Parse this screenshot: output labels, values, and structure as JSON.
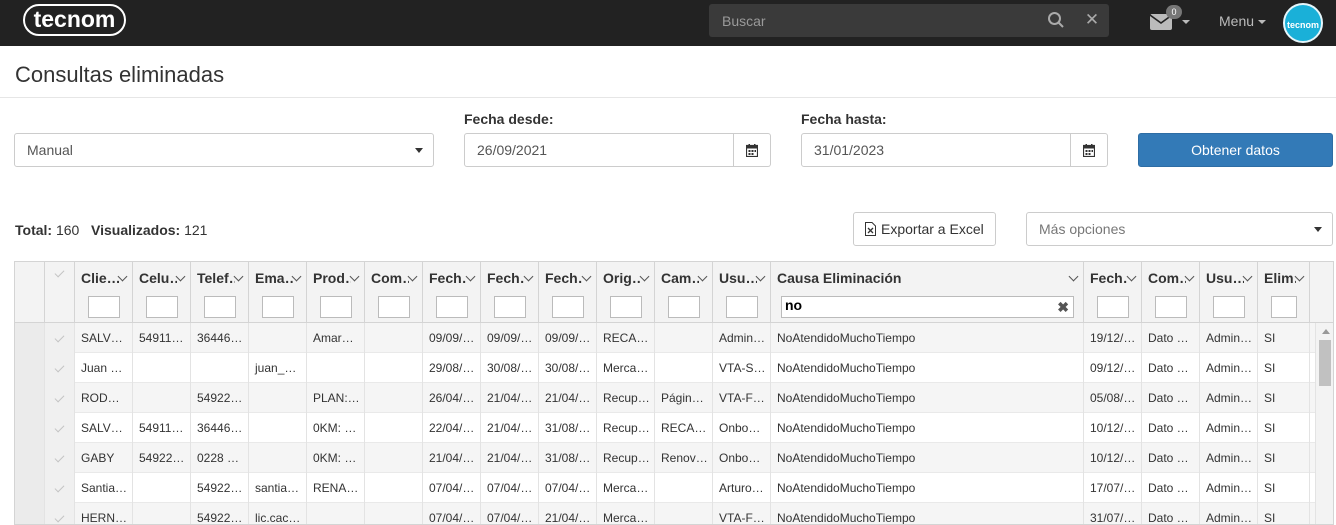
{
  "app": {
    "logo_text": "tecnom",
    "avatar_text": "tecnom",
    "accent": "#337ab7"
  },
  "topbar": {
    "search_placeholder": "Buscar",
    "mail_count": "0",
    "menu_label": "Menu"
  },
  "page": {
    "title": "Consultas eliminadas"
  },
  "filters": {
    "type_value": "Manual",
    "date_from_label": "Fecha desde:",
    "date_from_value": "26/09/2021",
    "date_to_label": "Fecha hasta:",
    "date_to_value": "31/01/2023",
    "submit_label": "Obtener datos"
  },
  "summary": {
    "total_label": "Total:",
    "total_value": "160",
    "visible_label": "Visualizados:",
    "visible_value": "121",
    "export_label": "Exportar a Excel",
    "more_options_value": "Más opciones"
  },
  "grid": {
    "columns": [
      "Clie…",
      "Celu…",
      "Telef…",
      "Ema…",
      "Prod…",
      "Com…",
      "Fech…",
      "Fech…",
      "Fech…",
      "Orig…",
      "Cam…",
      "Usu…",
      "Causa Eliminación",
      "Fech…",
      "Com…",
      "Usu…",
      "Elim…"
    ],
    "filter_values": [
      "",
      "",
      "",
      "",
      "",
      "",
      "",
      "",
      "",
      "",
      "",
      "",
      "no",
      "",
      "",
      "",
      ""
    ],
    "rows": [
      [
        "SALV…",
        "54911…",
        "36446…",
        "",
        "Amar…",
        "",
        "09/09/…",
        "09/09/…",
        "09/09/…",
        "RECA…",
        "",
        "Admin…",
        "NoAtendidoMuchoTiempo",
        "19/12/…",
        "Dato …",
        "Admin…",
        "SI"
      ],
      [
        "Juan …",
        "",
        "",
        "juan_…",
        "",
        "",
        "29/08/…",
        "30/08/…",
        "30/08/…",
        "Merca…",
        "",
        "VTA-S…",
        "NoAtendidoMuchoTiempo",
        "09/12/…",
        "Dato …",
        "Admin…",
        "SI"
      ],
      [
        "ROD…",
        "",
        "54922…",
        "",
        "PLAN:…",
        "",
        "26/04/…",
        "21/04/…",
        "21/04/…",
        "Recup…",
        "Págin…",
        "VTA-F…",
        "NoAtendidoMuchoTiempo",
        "05/08/…",
        "Dato …",
        "Admin…",
        "SI"
      ],
      [
        "SALV…",
        "54911…",
        "36446…",
        "",
        "0KM: …",
        "",
        "22/04/…",
        "21/04/…",
        "31/08/…",
        "Recup…",
        "RECA…",
        "Onbo…",
        "NoAtendidoMuchoTiempo",
        "10/12/…",
        "Dato …",
        "Admin…",
        "SI"
      ],
      [
        "GABY",
        "54922…",
        "0228 …",
        "",
        "0KM: …",
        "",
        "21/04/…",
        "21/04/…",
        "31/08/…",
        "Recup…",
        "Renov…",
        "Onbo…",
        "NoAtendidoMuchoTiempo",
        "10/12/…",
        "Dato …",
        "Admin…",
        "SI"
      ],
      [
        "Santia…",
        "",
        "54922…",
        "santia…",
        "RENA…",
        "",
        "07/04/…",
        "07/04/…",
        "07/04/…",
        "Merca…",
        "",
        "Arturo…",
        "NoAtendidoMuchoTiempo",
        "17/07/…",
        "Dato …",
        "Admin…",
        "SI"
      ],
      [
        "HERN…",
        "",
        "54922…",
        "lic.cac…",
        "",
        "",
        "07/04/…",
        "07/04/…",
        "21/04/…",
        "Merca…",
        "",
        "VTA-F…",
        "NoAtendidoMuchoTiempo",
        "31/07/…",
        "Dato …",
        "Admin…",
        "SI"
      ]
    ]
  }
}
